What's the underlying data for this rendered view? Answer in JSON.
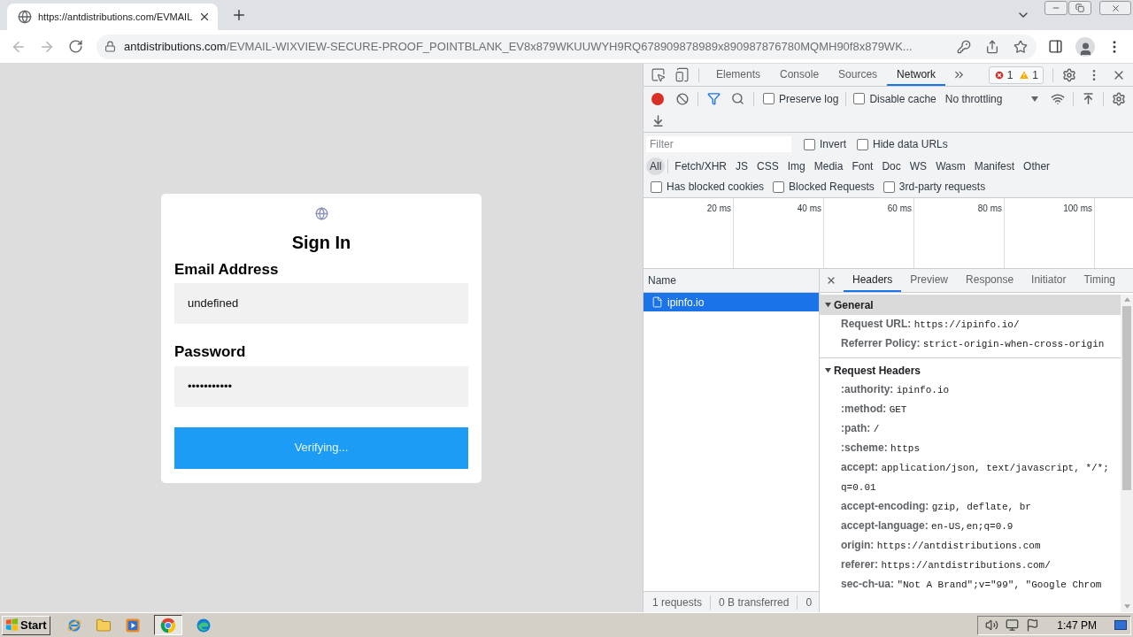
{
  "browser": {
    "tabs": [
      {
        "title": "https://antdistributions.com/EVMAIL",
        "selected": true
      }
    ],
    "address": {
      "host": "antdistributions.com",
      "path": "/EVMAIL-WIXVIEW-SECURE-PROOF_POINTBLANK_EV8x879WKUUWYH9RQ678909878989x890987876780MQMH90f8x879WK..."
    }
  },
  "page": {
    "title": "Sign In",
    "fields": [
      {
        "label": "Email Address",
        "value": "undefined"
      },
      {
        "label": "Password",
        "value": "•••••••••••"
      }
    ],
    "button": "Verifying..."
  },
  "devtools": {
    "tabs": [
      {
        "label": "Elements",
        "selected": false
      },
      {
        "label": "Console",
        "selected": false
      },
      {
        "label": "Sources",
        "selected": false
      },
      {
        "label": "Network",
        "selected": true
      }
    ],
    "issues": {
      "errors": "1",
      "warnings": "1"
    },
    "toolbar": {
      "recording": true,
      "filter_shown": true,
      "options": [
        {
          "label": "Preserve log",
          "checked": false
        },
        {
          "label": "Disable cache",
          "checked": false
        }
      ],
      "throttling": "No throttling"
    },
    "filter": {
      "placeholder": "Filter",
      "options": [
        {
          "label": "Invert",
          "checked": false
        },
        {
          "label": "Hide data URLs",
          "checked": false
        }
      ]
    },
    "types": [
      {
        "label": "All",
        "selected": true
      },
      {
        "label": "Fetch/XHR",
        "selected": false
      },
      {
        "label": "JS",
        "selected": false
      },
      {
        "label": "CSS",
        "selected": false
      },
      {
        "label": "Img",
        "selected": false
      },
      {
        "label": "Media",
        "selected": false
      },
      {
        "label": "Font",
        "selected": false
      },
      {
        "label": "Doc",
        "selected": false
      },
      {
        "label": "WS",
        "selected": false
      },
      {
        "label": "Wasm",
        "selected": false
      },
      {
        "label": "Manifest",
        "selected": false
      },
      {
        "label": "Other",
        "selected": false
      }
    ],
    "blocked_options": [
      {
        "label": "Has blocked cookies",
        "checked": false
      },
      {
        "label": "Blocked Requests",
        "checked": false
      },
      {
        "label": "3rd-party requests",
        "checked": false
      }
    ],
    "timeline": {
      "ticks": [
        "20 ms",
        "40 ms",
        "60 ms",
        "80 ms",
        "100 ms"
      ]
    },
    "requests": {
      "column": "Name",
      "rows": [
        {
          "name": "ipinfo.io",
          "selected": true
        }
      ],
      "status": [
        "1 requests",
        "0 B transferred",
        "0"
      ]
    },
    "details": {
      "tabs": [
        {
          "label": "Headers",
          "selected": true
        },
        {
          "label": "Preview",
          "selected": false
        },
        {
          "label": "Response",
          "selected": false
        },
        {
          "label": "Initiator",
          "selected": false
        },
        {
          "label": "Timing",
          "selected": false
        }
      ],
      "sections": [
        {
          "title": "General",
          "expanded": true,
          "focused": true,
          "rows": [
            {
              "name": "Request URL:",
              "value": "https://ipinfo.io/"
            },
            {
              "name": "Referrer Policy:",
              "value": "strict-origin-when-cross-origin"
            }
          ]
        },
        {
          "title": "Request Headers",
          "expanded": true,
          "focused": false,
          "rows": [
            {
              "name": ":authority:",
              "value": "ipinfo.io"
            },
            {
              "name": ":method:",
              "value": "GET"
            },
            {
              "name": ":path:",
              "value": "/"
            },
            {
              "name": ":scheme:",
              "value": "https"
            },
            {
              "name": "accept:",
              "value": "application/json, text/javascript, */*; q=0.01"
            },
            {
              "name": "accept-encoding:",
              "value": "gzip, deflate, br"
            },
            {
              "name": "accept-language:",
              "value": "en-US,en;q=0.9"
            },
            {
              "name": "origin:",
              "value": "https://antdistributions.com"
            },
            {
              "name": "referer:",
              "value": "https://antdistributions.com/"
            },
            {
              "name": "sec-ch-ua:",
              "value": "\"Not A Brand\";v=\"99\", \"Google Chrom"
            }
          ]
        }
      ]
    }
  },
  "taskbar": {
    "start": "Start",
    "apps": [
      {
        "active": false
      },
      {
        "active": false
      },
      {
        "active": false
      },
      {
        "active": true
      },
      {
        "active": false
      }
    ],
    "clock": "1:47 PM"
  }
}
